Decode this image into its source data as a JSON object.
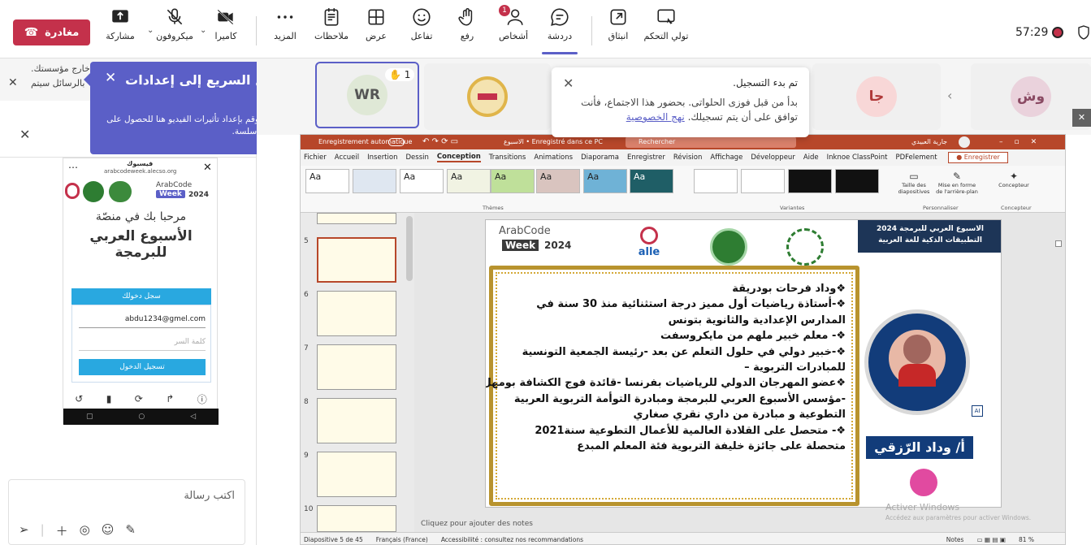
{
  "toolbar": {
    "timer": "57:29",
    "leave_label": "مغادرة",
    "share_label": "مشاركة",
    "mic_label": "ميكروفون",
    "camera_label": "كاميرا",
    "more_label": "المزيد",
    "notes_label": "ملاحظات",
    "view_label": "عرض",
    "react_label": "تفاعل",
    "raise_label": "رفع",
    "people_label": "أشخاص",
    "people_badge": "1",
    "chat_label": "دردشة",
    "popout_label": "انبثاق",
    "control_label": "تولي التحكم"
  },
  "tooltip": {
    "title": "الوصول السريع إلى إعدادات الفيديو",
    "body": "حدد الكاميرا وقم بإعداد تأثيرات الفيديو هنا للحصول على تجربة اجتماع سلسة."
  },
  "banner": {
    "line1": "خارج مؤسستك.",
    "line2": "بالرسائل سيتم"
  },
  "phone": {
    "app_name": "فيسبوك",
    "url": "arabcodeweek.alecso.org",
    "welcome": "مرحبا بك في منصّة",
    "headline1": "الأسبوع العربي",
    "headline2": "للبرمجة",
    "login_header": "سجل دخولك",
    "email_value": "abdu1234@gmel.com",
    "password_placeholder": "كلمة السر",
    "submit_label": "تسجيل الدخول",
    "logo_text1": "ArabCode",
    "logo_text2": "Week",
    "logo_year": "2024"
  },
  "chat": {
    "placeholder": "اكتب رسالة"
  },
  "participants": {
    "tile1_initials": "وش",
    "tile2_initials": "جا",
    "tile3_initials": "WR",
    "raise_count": "1"
  },
  "notice": {
    "title": "تم بدء التسجيل.",
    "body": "بدأ من قبل فوزى الحلواتى. بحضور هذا الاجتماع، فأنت توافق على أن يتم تسجيلك.",
    "link": "نهج الخصوصية"
  },
  "ppt": {
    "autosave": "Enregistrement automatique",
    "doc_title": "الاسبوع • Enregistré dans ce PC",
    "search": "Rechercher",
    "user": "جارية العبيدي",
    "record_btn": "Enregistrer",
    "tabs": [
      "Fichier",
      "Accueil",
      "Insertion",
      "Dessin",
      "Conception",
      "Transitions",
      "Animations",
      "Diaporama",
      "Enregistrer",
      "Révision",
      "Affichage",
      "Développeur",
      "Aide",
      "Inknoe ClassPoint",
      "PDFelement"
    ],
    "group_themes": "Thèmes",
    "group_variants": "Variantes",
    "group_custom": "Personnaliser",
    "group_designer": "Concepteur",
    "slide_size": "Taille des diapositives",
    "bg_format": "Mise en forme de l'arrière-plan",
    "designer": "Concepteur",
    "theme_label": "Aa",
    "slide_numbers": [
      "5",
      "6",
      "7",
      "8",
      "9",
      "10"
    ],
    "notes_placeholder": "Cliquez pour ajouter des notes",
    "watermark1": "Activer Windows",
    "watermark2": "Accédez aux paramètres pour activer Windows.",
    "status_slide": "Diapositive 5 de 45",
    "status_lang": "Français (France)",
    "status_access": "Accessibilité : consultez nos recommandations",
    "status_notes": "Notes",
    "zoom": "81 %"
  },
  "slide": {
    "header_line1": "الاسبوع العربي للبرمجة 2024",
    "header_line2": "التطبيقات الذكية للغة العربية",
    "logo_text1": "ArabCode",
    "logo_text2": "Week",
    "logo_year": "2024",
    "alecso_text": "alle",
    "name_banner": "أ/ وداد الرّزقي",
    "lines": [
      "❖وداد فرحات بودريقة",
      "❖-أستاذة رياضيات أول مميز درجة استثنائية منذ 30 سنة في",
      "المدارس الإعدادية والثانوية بتونس",
      "❖- معلم خبير ملهم من مايكروسفت",
      "❖-خبير دولي في حلول التعلم عن بعد -رئيسة الجمعية التونسية",
      "للمبادرات التربوية –",
      "❖عضو المهرجان الدولي للرياضيات بفرنسا -قائدة فوج الكشافة بومهل",
      "-مؤسس الأسبوع العربي للبرمجة ومبادرة التوأمة التربوية العربية",
      "التطوعية و مبادرة من داري نقري صغاري",
      "❖- متحصل على القلادة العالمية للأعمال التطوعية سنة2021",
      "متحصلة على جائزة خليفة التربوية فئة المعلم المبدع"
    ]
  },
  "colors": {
    "accent": "#5b5fc7",
    "leave": "#c4314b",
    "ppt": "#b7472a",
    "frame": "#b8932e"
  }
}
